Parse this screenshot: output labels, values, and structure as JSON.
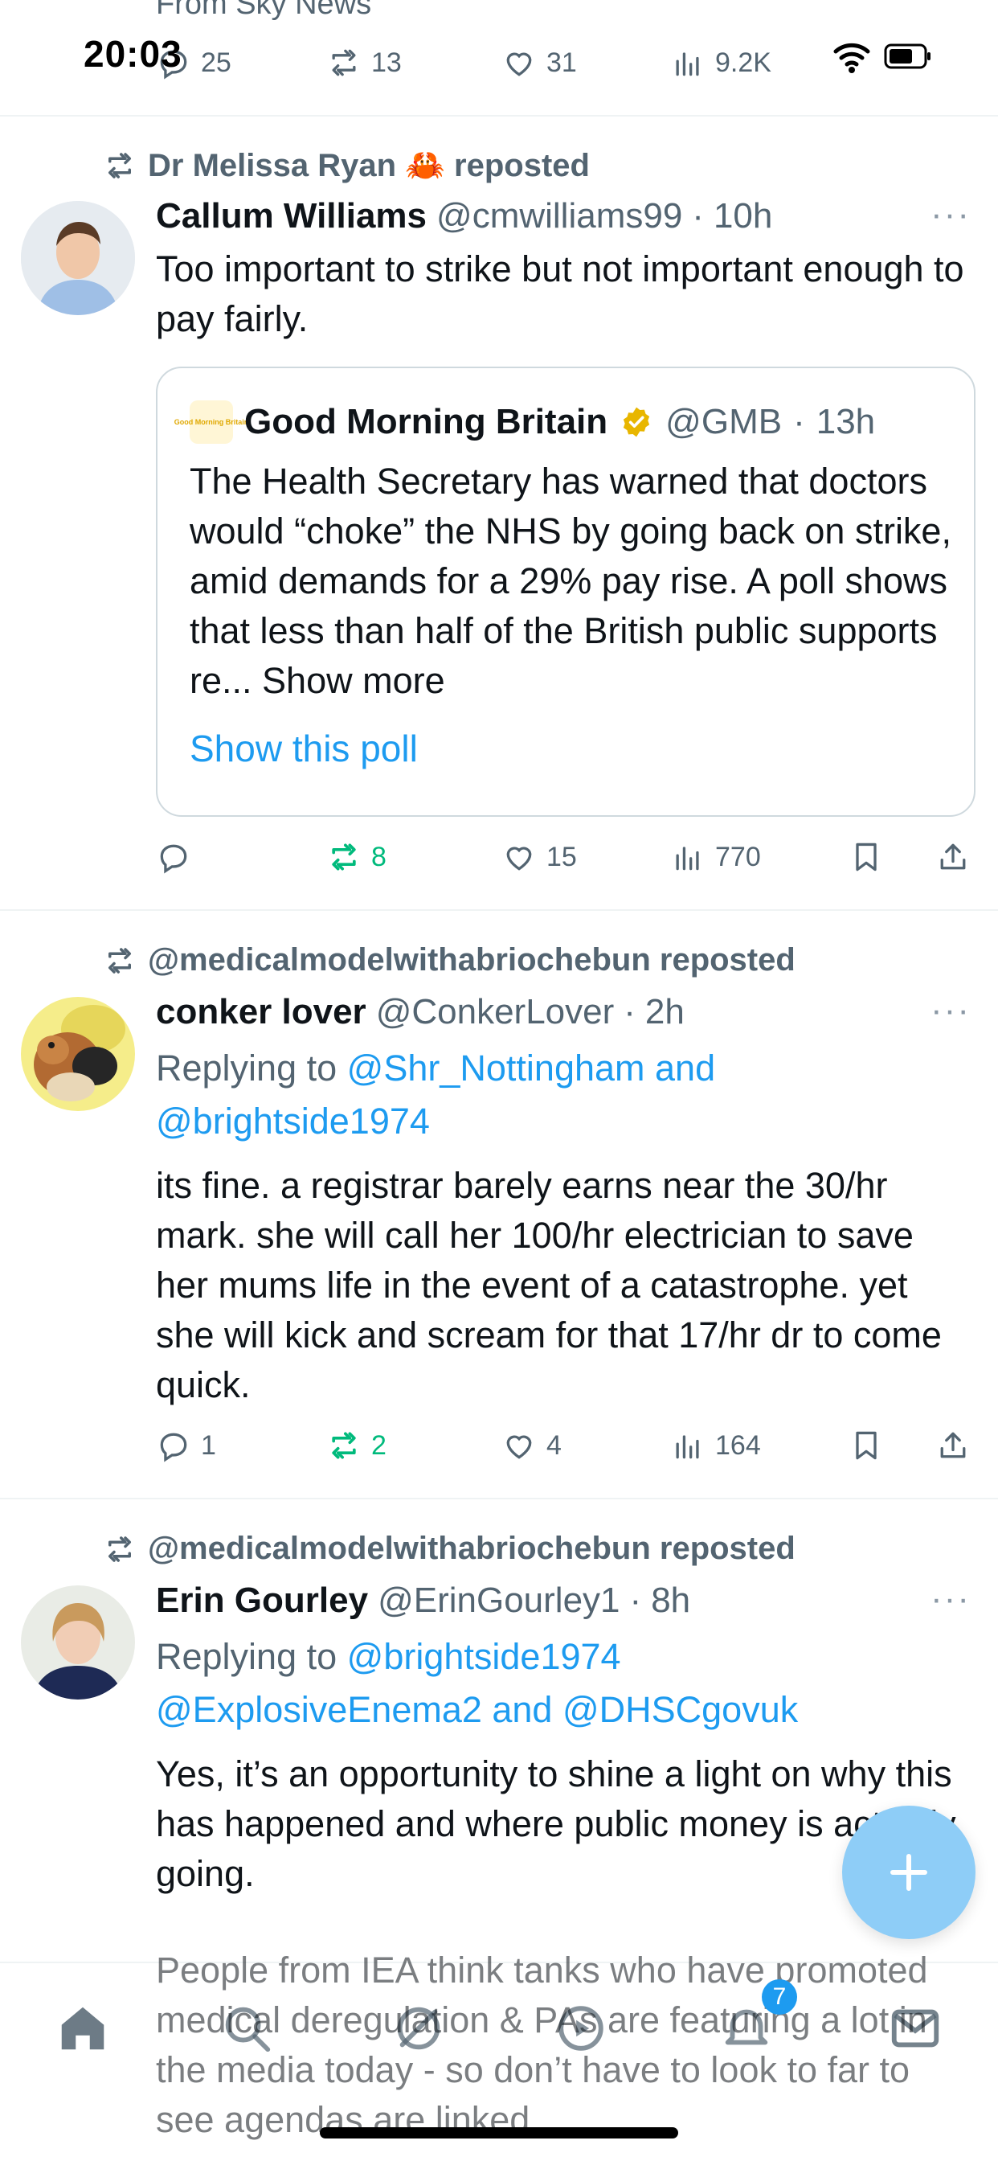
{
  "status_bar": {
    "time": "20:03"
  },
  "top_tweet": {
    "source_label": "From Sky News",
    "reply_count": "25",
    "repost_count": "13",
    "like_count": "31",
    "view_count": "9.2K"
  },
  "tweets": [
    {
      "reposted_by": "Dr Melissa Ryan 🦀 reposted",
      "name": "Callum Williams",
      "handle": "@cmwilliams99",
      "time": "10h",
      "text": "Too important to strike but not important enough to pay fairly.",
      "quote": {
        "logo_text": "Good Morning Britain",
        "name": "Good Morning Britain",
        "handle": "@GMB",
        "time": "13h",
        "text": "The Health Secretary has warned that doctors would “choke” the NHS by going back on strike, amid demands for a 29% pay rise. A poll shows that less than half of the British public supports re...",
        "show_more": "Show more",
        "poll_link": "Show this poll"
      },
      "reply_count": "",
      "repost_count": "8",
      "like_count": "15",
      "view_count": "770"
    },
    {
      "reposted_by": "@medicalmodelwithabriochebun reposted",
      "name": "conker lover",
      "handle": "@ConkerLover",
      "time": "2h",
      "replying_prefix": "Replying to",
      "replying_to_1": "@Shr_Nottingham and",
      "replying_to_2": "@brightside1974",
      "text": "its fine. a registrar barely earns near the 30/hr mark. she will call her 100/hr electrician to save her mums life in the event of a catastrophe. yet she will kick and scream for that 17/hr dr to come quick.",
      "reply_count": "1",
      "repost_count": "2",
      "like_count": "4",
      "view_count": "164"
    },
    {
      "reposted_by": "@medicalmodelwithabriochebun reposted",
      "name": "Erin Gourley",
      "handle": "@ErinGourley1",
      "time": "8h",
      "replying_prefix": "Replying to",
      "replying_to_1": "@brightside1974",
      "replying_to_2": "@ExplosiveEnema2 and @DHSCgovuk",
      "text": "Yes, it’s an opportunity to shine a light on why this has happened and where public money is actually going.",
      "text_2": "People from IEA think tanks who have promoted medical deregulation & PAs are featuring a lot in the media today - so don’t have to look to far to see agendas are linked."
    }
  ],
  "separator": "·",
  "more_icon": "···",
  "nav": {
    "notifications_badge": "7",
    "icons": [
      "home-icon",
      "search-icon",
      "grok-icon",
      "spaces-icon",
      "notifications-icon",
      "messages-icon"
    ]
  },
  "colors": {
    "accent": "#1d9bf0",
    "repost_green": "#00ba7c",
    "muted": "#536471"
  }
}
